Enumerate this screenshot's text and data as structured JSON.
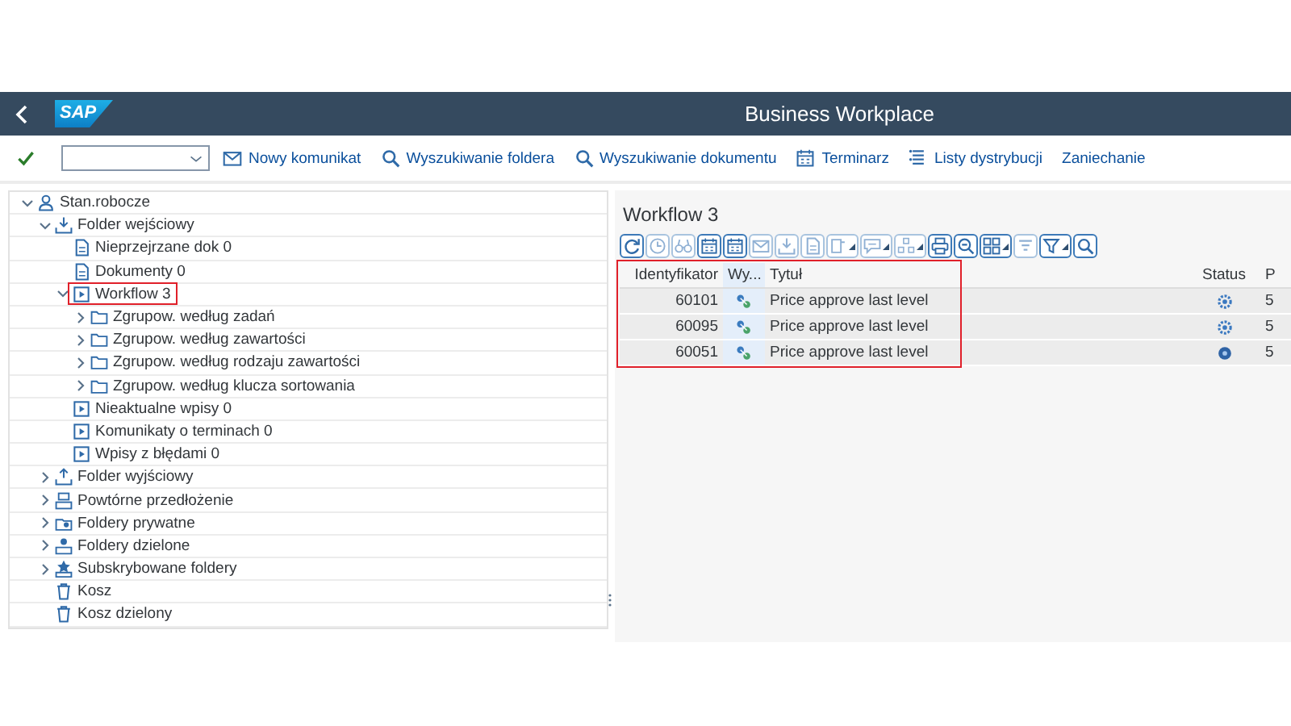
{
  "header": {
    "logo": "SAP",
    "title": "Business Workplace"
  },
  "toolbar": {
    "buttons": [
      {
        "kind": "message",
        "label": "Nowy komunikat"
      },
      {
        "kind": "search",
        "label": "Wyszukiwanie foldera"
      },
      {
        "kind": "search",
        "label": "Wyszukiwanie dokumentu"
      },
      {
        "kind": "calendar",
        "label": "Terminarz"
      },
      {
        "kind": "list",
        "label": "Listy dystrybucji"
      },
      {
        "kind": "none",
        "label": "Zaniechanie"
      }
    ]
  },
  "tree": [
    {
      "kind": "user",
      "label": "Stan.robocze",
      "expanded": true,
      "highlighted": false,
      "children": [
        {
          "kind": "inbox",
          "label": "Folder wejściowy",
          "expanded": true,
          "highlighted": false,
          "children": [
            {
              "kind": "doc",
              "label": "Nieprzejrzane dok 0",
              "highlighted": false
            },
            {
              "kind": "doc",
              "label": "Dokumenty 0",
              "highlighted": false
            },
            {
              "kind": "workflow",
              "label": "Workflow 3",
              "expanded": true,
              "highlighted": true,
              "children": [
                {
                  "kind": "folder",
                  "label": "Zgrupow. według zadań",
                  "expanded": false,
                  "highlighted": false
                },
                {
                  "kind": "folder",
                  "label": "Zgrupow. według zawartości",
                  "expanded": false,
                  "highlighted": false
                },
                {
                  "kind": "folder",
                  "label": "Zgrupow. według rodzaju zawartości",
                  "expanded": false,
                  "highlighted": false
                },
                {
                  "kind": "folder",
                  "label": "Zgrupow. według klucza sortowania",
                  "expanded": false,
                  "highlighted": false
                }
              ]
            },
            {
              "kind": "workflow",
              "label": "Nieaktualne wpisy 0",
              "highlighted": false
            },
            {
              "kind": "workflow",
              "label": "Komunikaty o terminach 0",
              "highlighted": false
            },
            {
              "kind": "workflow",
              "label": "Wpisy z błędami 0",
              "highlighted": false
            }
          ]
        },
        {
          "kind": "outbox",
          "label": "Folder wyjściowy",
          "expanded": false,
          "highlighted": false
        },
        {
          "kind": "resubmit",
          "label": "Powtórne przedłożenie",
          "expanded": false,
          "highlighted": false
        },
        {
          "kind": "private",
          "label": "Foldery prywatne",
          "expanded": false,
          "highlighted": false
        },
        {
          "kind": "shared",
          "label": "Foldery dzielone",
          "expanded": false,
          "highlighted": false
        },
        {
          "kind": "subscribed",
          "label": "Subskrybowane foldery",
          "expanded": false,
          "highlighted": false
        },
        {
          "kind": "trash",
          "label": "Kosz",
          "highlighted": false
        },
        {
          "kind": "trash",
          "label": "Kosz dzielony",
          "highlighted": false
        }
      ]
    }
  ],
  "content": {
    "title": "Workflow 3",
    "alv_toolbar": [
      {
        "kind": "refresh",
        "disabled": false,
        "menu": false
      },
      {
        "kind": "clock",
        "disabled": true,
        "menu": false
      },
      {
        "kind": "binoculars",
        "disabled": true,
        "menu": false
      },
      {
        "kind": "calendar",
        "disabled": false,
        "menu": false
      },
      {
        "kind": "calendar",
        "disabled": false,
        "menu": false
      },
      {
        "kind": "mail",
        "disabled": true,
        "menu": false
      },
      {
        "kind": "inbox",
        "disabled": true,
        "menu": false
      },
      {
        "kind": "doc",
        "disabled": true,
        "menu": false
      },
      {
        "kind": "note",
        "disabled": true,
        "menu": true
      },
      {
        "kind": "comment",
        "disabled": true,
        "menu": true
      },
      {
        "kind": "org",
        "disabled": true,
        "menu": true
      },
      {
        "kind": "print",
        "disabled": false,
        "menu": false
      },
      {
        "kind": "zoom",
        "disabled": false,
        "menu": false
      },
      {
        "kind": "layout",
        "disabled": false,
        "menu": true
      },
      {
        "kind": "sum",
        "disabled": true,
        "menu": false
      },
      {
        "kind": "filter",
        "disabled": false,
        "menu": true
      },
      {
        "kind": "search",
        "disabled": false,
        "menu": false
      }
    ],
    "table": {
      "highlighted": true,
      "columns": [
        {
          "label": "Identyfikator",
          "selected": false
        },
        {
          "label": "Wy...",
          "selected": true
        },
        {
          "label": "Tytuł",
          "selected": false
        },
        {
          "label": "Status",
          "selected": false
        },
        {
          "label": "P",
          "selected": false
        }
      ],
      "rows": [
        {
          "id": "60101",
          "kind": "workflow",
          "title": "Price approve last level",
          "status": {
            "kind": "ready"
          },
          "column_5": "5"
        },
        {
          "id": "60095",
          "kind": "workflow",
          "title": "Price approve last level",
          "status": {
            "kind": "ready"
          },
          "column_5": "5"
        },
        {
          "id": "60051",
          "kind": "workflow",
          "title": "Price approve last level",
          "status": {
            "kind": "started"
          },
          "column_5": "5"
        }
      ]
    }
  }
}
